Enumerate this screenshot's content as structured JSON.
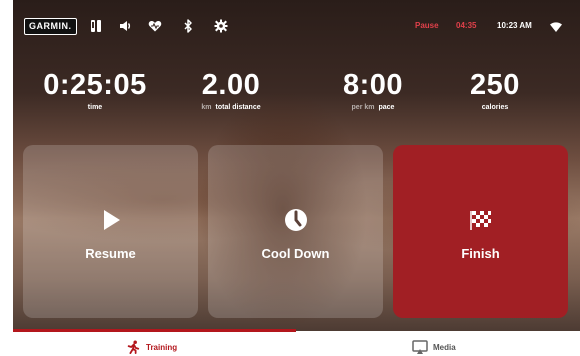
{
  "topbar": {
    "brand": "GARMIN.",
    "status_pause": "Pause",
    "status_timer": "04:35",
    "clock": "10:23 AM",
    "icons": [
      "phone-icon",
      "volume-icon",
      "heart-rate-icon",
      "bluetooth-icon",
      "settings-icon",
      "wifi-icon"
    ]
  },
  "metrics": [
    {
      "value": "0:25:05",
      "unit": "",
      "label": "time"
    },
    {
      "value": "2.00",
      "unit": "km",
      "label": "total distance"
    },
    {
      "value": "8:00",
      "unit": "per km",
      "label": "pace"
    },
    {
      "value": "250",
      "unit": "",
      "label": "calories"
    }
  ],
  "actions": {
    "resume": "Resume",
    "cooldown": "Cool Down",
    "finish": "Finish"
  },
  "tabs": {
    "training": "Training",
    "media": "Media"
  },
  "colors": {
    "accent": "#b3161c",
    "finish_bg": "#a11f24",
    "alert_text": "#e0404a"
  }
}
